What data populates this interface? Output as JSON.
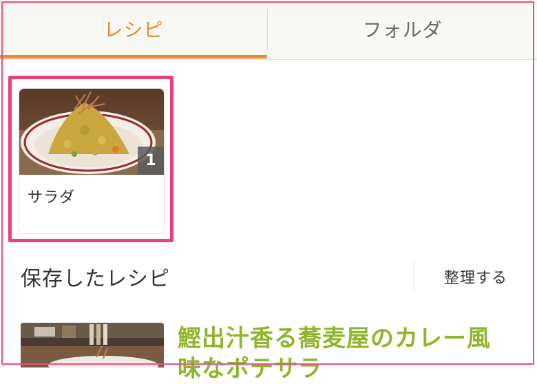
{
  "tabs": {
    "recipe_label": "レシピ",
    "folder_label": "フォルダ",
    "active_color": "#ef8a2b"
  },
  "folder_card": {
    "title": "サラダ",
    "count": "1",
    "highlight_color": "#ef3f7a"
  },
  "saved": {
    "title": "保存したレシピ",
    "organize_label": "整理する"
  },
  "recipe": {
    "title_line1": "鰹出汁香る蕎麦屋のカレー風",
    "title_line2": "味なポテサラ",
    "title_color": "#8fb52a"
  }
}
